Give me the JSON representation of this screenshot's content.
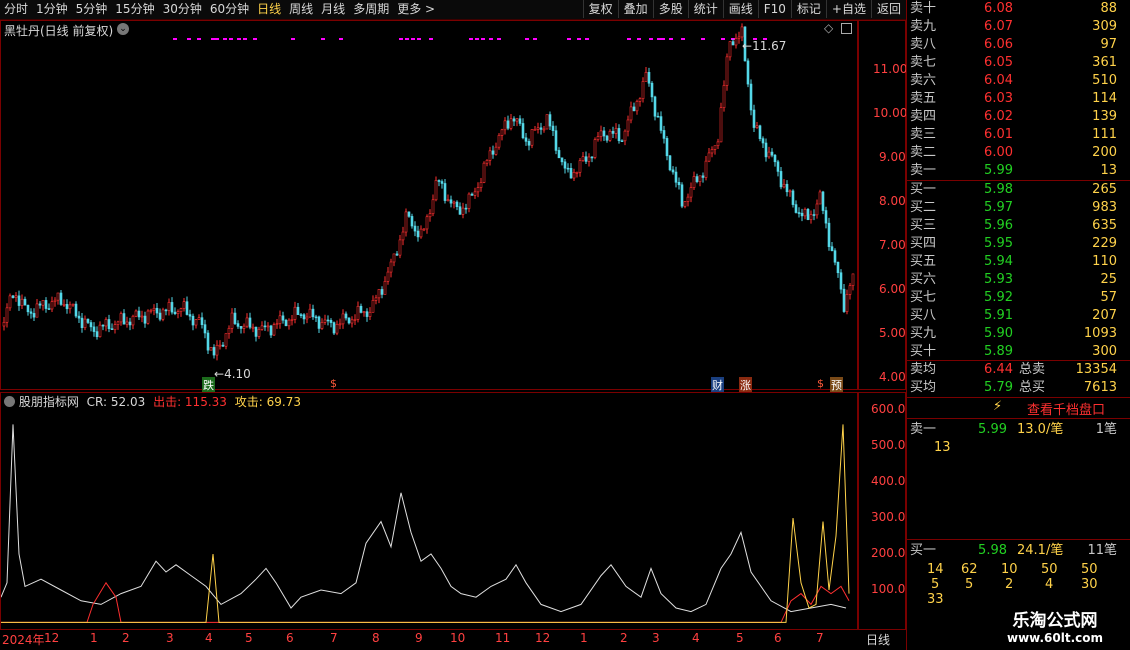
{
  "toolbar": {
    "periods": [
      "分时",
      "1分钟",
      "5分钟",
      "15分钟",
      "30分钟",
      "60分钟",
      "日线",
      "周线",
      "月线",
      "多周期",
      "更多 >"
    ],
    "active_period": "日线",
    "buttons": [
      "复权",
      "叠加",
      "多股",
      "统计",
      "画线",
      "F10",
      "标记",
      "+自选",
      "返回"
    ]
  },
  "main_chart": {
    "title": "黑牡丹(日线 前复权)",
    "price_labels": [
      "11.00",
      "10.00",
      "9.00",
      "8.00",
      "7.00",
      "6.00",
      "5.00",
      "4.00"
    ],
    "high_label": "11.67",
    "low_label": "4.10",
    "markers": [
      "跌",
      "$",
      "财",
      "涨",
      "$",
      "预"
    ]
  },
  "indicator": {
    "name": "股朋指标网",
    "cr_label": "CR: 52.03",
    "out_label": "出击: 115.33",
    "attack_label": "攻击: 69.73",
    "axis_labels": [
      "600.0",
      "500.0",
      "400.0",
      "300.0",
      "200.0",
      "100.0"
    ]
  },
  "date_axis": {
    "labels": [
      "2024年",
      "12",
      "1",
      "2",
      "3",
      "4",
      "5",
      "6",
      "7",
      "8",
      "9",
      "10",
      "11",
      "12",
      "1",
      "2",
      "3",
      "4",
      "5",
      "6",
      "7"
    ],
    "period_label": "日线"
  },
  "order_book": {
    "sell": [
      {
        "name": "卖十",
        "price": "6.08",
        "vol": "88"
      },
      {
        "name": "卖九",
        "price": "6.07",
        "vol": "309"
      },
      {
        "name": "卖八",
        "price": "6.06",
        "vol": "97"
      },
      {
        "name": "卖七",
        "price": "6.05",
        "vol": "361"
      },
      {
        "name": "卖六",
        "price": "6.04",
        "vol": "510"
      },
      {
        "name": "卖五",
        "price": "6.03",
        "vol": "114"
      },
      {
        "name": "卖四",
        "price": "6.02",
        "vol": "139"
      },
      {
        "name": "卖三",
        "price": "6.01",
        "vol": "111"
      },
      {
        "name": "卖二",
        "price": "6.00",
        "vol": "200"
      },
      {
        "name": "卖一",
        "price": "5.99",
        "vol": "13"
      }
    ],
    "buy": [
      {
        "name": "买一",
        "price": "5.98",
        "vol": "265"
      },
      {
        "name": "买二",
        "price": "5.97",
        "vol": "983"
      },
      {
        "name": "买三",
        "price": "5.96",
        "vol": "635"
      },
      {
        "name": "买四",
        "price": "5.95",
        "vol": "229"
      },
      {
        "name": "买五",
        "price": "5.94",
        "vol": "110"
      },
      {
        "name": "买六",
        "price": "5.93",
        "vol": "25"
      },
      {
        "name": "买七",
        "price": "5.92",
        "vol": "57"
      },
      {
        "name": "买八",
        "price": "5.91",
        "vol": "207"
      },
      {
        "name": "买九",
        "price": "5.90",
        "vol": "1093"
      },
      {
        "name": "买十",
        "price": "5.89",
        "vol": "300"
      }
    ],
    "avg_sell": {
      "name": "卖均",
      "price": "6.44",
      "total_label": "总卖",
      "total": "13354"
    },
    "avg_buy": {
      "name": "买均",
      "price": "5.79",
      "total_label": "总买",
      "total": "7613"
    },
    "thousand_button": "查看千档盘口",
    "sell1_detail": {
      "name": "卖一",
      "price": "5.99",
      "per": "13.0/笔",
      "count": "1笔",
      "queue": [
        "13"
      ]
    },
    "buy1_detail": {
      "name": "买一",
      "price": "5.98",
      "per": "24.1/笔",
      "count": "11笔",
      "queue_row1": [
        "14",
        "62",
        "10",
        "50",
        "50"
      ],
      "queue_row2": [
        "5",
        "5",
        "2",
        "4",
        "30"
      ],
      "queue_row3": [
        "33"
      ]
    }
  },
  "watermark": {
    "line1": "乐淘公式网",
    "line2": "www.60lt.com"
  },
  "colors": {
    "up": "#ff3030",
    "down": "#54d8e8",
    "grid": "#7a0000",
    "accent": "#ffd24a",
    "green": "#22d022"
  }
}
